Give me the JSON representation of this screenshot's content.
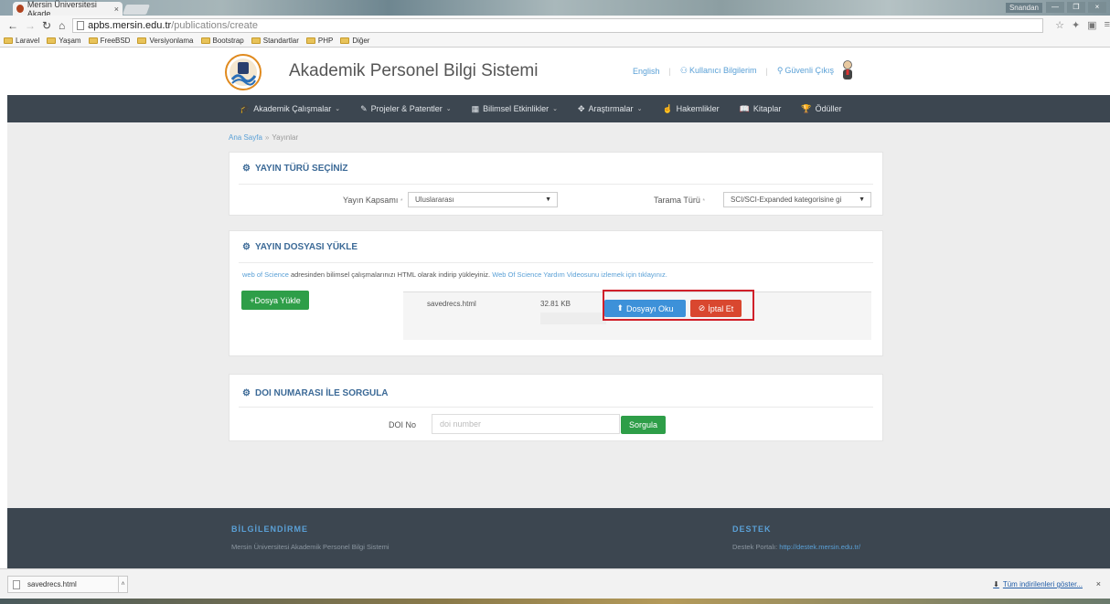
{
  "browser": {
    "tab_title": "Mersin Üniversitesi Akade",
    "tab_close": "×",
    "window_user": "Snandan",
    "window_controls": [
      "—",
      "❐",
      "×"
    ],
    "url_host": "apbs.mersin.edu.tr",
    "url_path": "/publications/create",
    "bookmarks": [
      "Laravel",
      "Yaşam",
      "FreeBSD",
      "Versiyonlama",
      "Bootstrap",
      "Standartlar",
      "PHP",
      "Diğer"
    ]
  },
  "header": {
    "site_title": "Akademik Personel Bilgi Sistemi",
    "english_label": "English",
    "profile_label": "Kullanıcı Bilgilerim",
    "logout_label": "Güvenli Çıkış"
  },
  "nav": {
    "items": [
      {
        "label": "Akademik Çalışmalar",
        "icon": "graduation-icon",
        "glyph": "🎓",
        "caret": "⌄"
      },
      {
        "label": "Projeler & Patentler",
        "icon": "pencil-icon",
        "glyph": "✎",
        "caret": "⌄"
      },
      {
        "label": "Bilimsel Etkinlikler",
        "icon": "calendar-icon",
        "glyph": "▦",
        "caret": "⌄"
      },
      {
        "label": "Araştırmalar",
        "icon": "compass-icon",
        "glyph": "✥",
        "caret": "⌄"
      },
      {
        "label": "Hakemlikler",
        "icon": "hand-icon",
        "glyph": "☝",
        "caret": ""
      },
      {
        "label": "Kitaplar",
        "icon": "book-icon",
        "glyph": "📖",
        "caret": ""
      },
      {
        "label": "Ödüller",
        "icon": "trophy-icon",
        "glyph": "🏆",
        "caret": ""
      }
    ]
  },
  "breadcrumb": {
    "home": "Ana Sayfa",
    "sep": "»",
    "current": "Yayınlar"
  },
  "publication_type": {
    "title": "YAYIN TÜRÜ SEÇİNİZ",
    "scope_label": "Yayın Kapsamı",
    "scope_value": "Uluslararası",
    "index_label": "Tarama Türü",
    "index_value": "SCI/SCI-Expanded kategorisine gi",
    "required_mark": "*"
  },
  "upload": {
    "title": "YAYIN DOSYASI YÜKLE",
    "info_link1": "web of Science",
    "info_text": " adresinden bilimsel çalışmalarınızı HTML olarak indirip yükleyiniz. ",
    "info_link2": "Web Of Science Yardım Videosunu izlemek için tıklayınız.",
    "upload_button": "+Dosya Yükle",
    "file_name": "savedrecs.html",
    "file_size": "32.81 KB",
    "read_button": "Dosyayı Oku",
    "cancel_button": "İptal Et"
  },
  "doi": {
    "title": "DOI NUMARASI İLE SORGULA",
    "label": "DOI No",
    "placeholder": "doi number",
    "button": "Sorgula"
  },
  "footer": {
    "info_heading": "BİLGİLENDİRME",
    "info_text": "Mersin Üniversitesi Akademik Personel Bilgi Sistemi",
    "support_heading": "DESTEK",
    "support_text": "Destek Portalı: ",
    "support_link": "http://destek.mersin.edu.tr/"
  },
  "downloads": {
    "file": "savedrecs.html",
    "show_all": "Tüm indirilenleri göster...",
    "close": "×"
  },
  "colors": {
    "accent": "#3c6a97",
    "link": "#5aa0d6",
    "nav_bg": "#3c4650",
    "success": "#2e9e48",
    "primary": "#3d91d9",
    "danger": "#d9472f",
    "highlight_frame": "#d0202a"
  }
}
